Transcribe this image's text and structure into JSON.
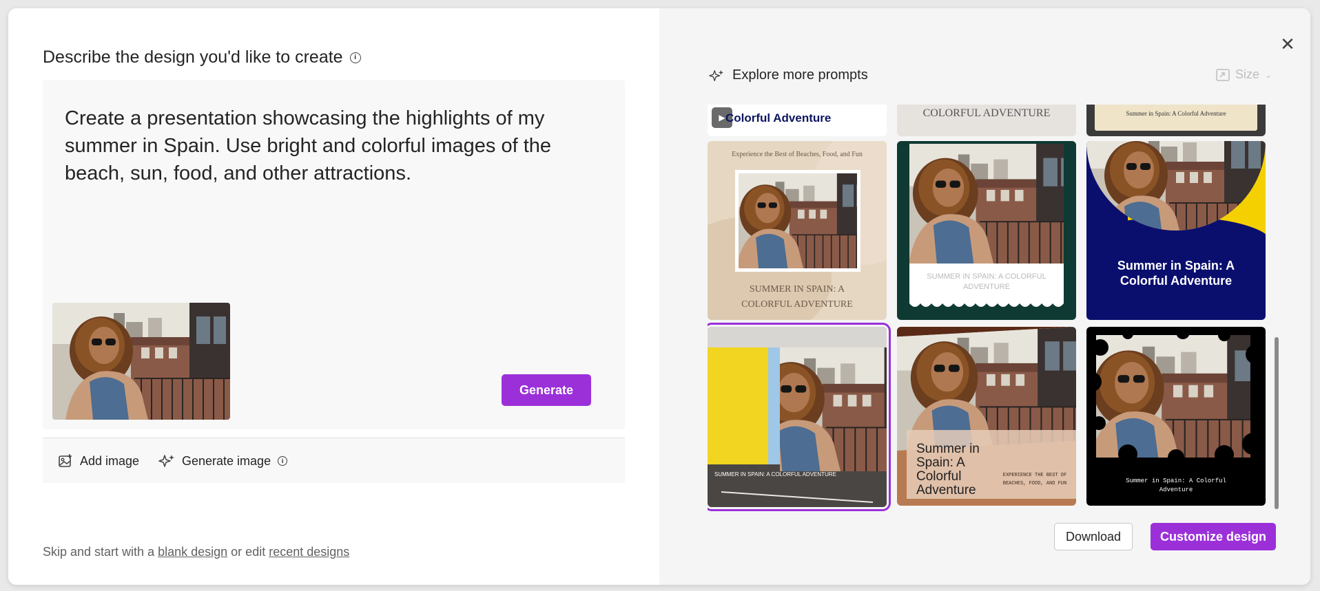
{
  "dialog": {
    "title": "Describe the design you'd like to create",
    "prompt": "Create a presentation showcasing the highlights of my summer in Spain. Use bright and colorful images of the beach, sun, food, and other attractions.",
    "add_image": "Add image",
    "generate_image": "Generate image",
    "generate": "Generate",
    "skip_prefix": "Skip and start with a ",
    "blank_design": "blank design",
    "skip_middle": " or edit ",
    "recent_designs": "recent designs"
  },
  "right": {
    "explore": "Explore more prompts",
    "size": "Size",
    "download": "Download",
    "customize": "Customize design"
  },
  "cards": {
    "top1": "Colorful Adventure",
    "top2": "COLORFUL ADVENTURE",
    "top3": "Summer in Spain: A Colorful Adventure",
    "c1_sub": "Experience the Best of Beaches, Food, and Fun",
    "c1_title": "SUMMER IN SPAIN: A COLORFUL ADVENTURE",
    "c2_title": "SUMMER IN SPAIN: A COLORFUL ADVENTURE",
    "c3_title": "Summer in Spain: A Colorful Adventure",
    "c4_title": "SUMMER IN SPAIN: A COLORFUL ADVENTURE",
    "c5_title": "Summer in Spain: A Colorful Adventure",
    "c5_sub": "EXPERIENCE THE BEST OF BEACHES, FOOD, AND FUN",
    "c6_title": "Summer in Spain: A Colorful Adventure"
  },
  "colors": {
    "accent": "#9b30d9",
    "dark_green": "#0f3a33",
    "navy": "#0a0f6e",
    "yellow": "#f5d000",
    "tan": "#e8d9c6",
    "brown": "#b87a52"
  }
}
